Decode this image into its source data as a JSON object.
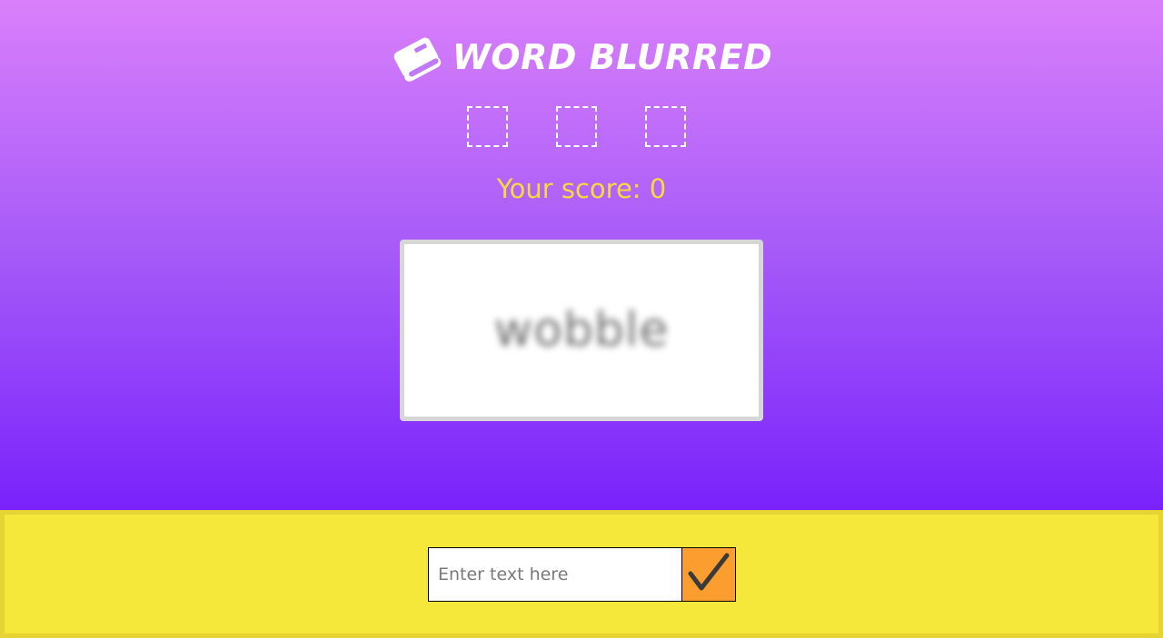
{
  "header": {
    "title": "WORD BLURRED",
    "icon": "book-icon"
  },
  "lives": {
    "slots": 3
  },
  "score": {
    "label": "Your score: ",
    "value": "0"
  },
  "word_card": {
    "word": "wobble"
  },
  "answer": {
    "placeholder": "Enter text here",
    "value": "",
    "submit_icon": "checkmark-icon"
  },
  "colors": {
    "gradient_top": "#d97ffb",
    "gradient_bottom": "#7a22fb",
    "score": "#f7d93e",
    "footer": "#f6e73b",
    "submit": "#fc9e2f"
  }
}
